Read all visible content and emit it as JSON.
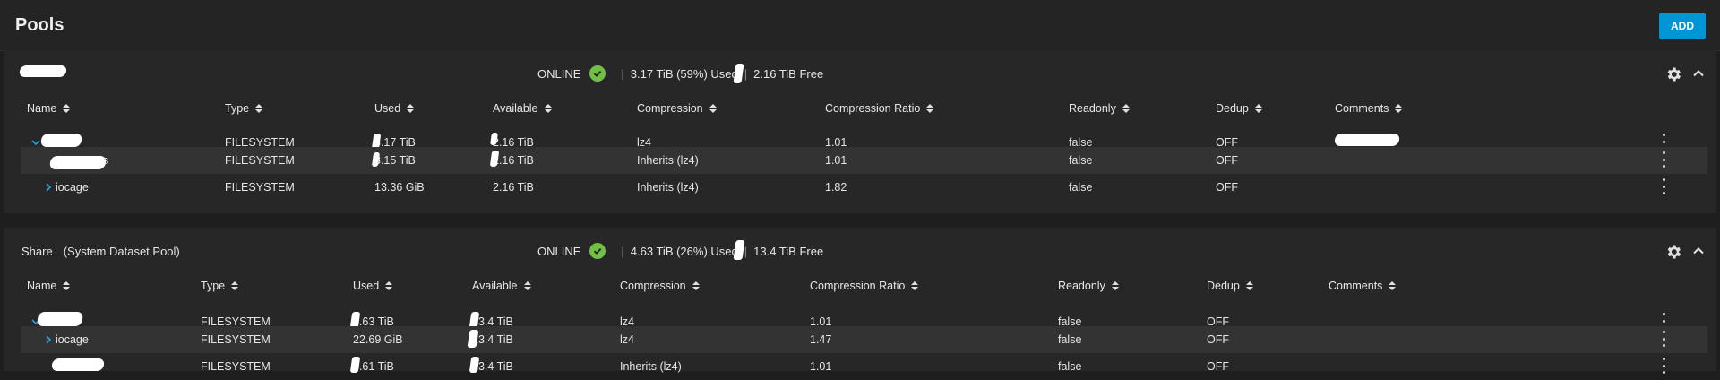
{
  "header": {
    "title": "Pools",
    "add_label": "ADD"
  },
  "columns": {
    "name": "Name",
    "type": "Type",
    "used": "Used",
    "available": "Available",
    "compression": "Compression",
    "ratio": "Compression Ratio",
    "readonly": "Readonly",
    "dedup": "Dedup",
    "comments": "Comments"
  },
  "pools": [
    {
      "name": "",
      "subtitle": "",
      "status": "ONLINE",
      "used_text": "3.17 TiB (59%) Used",
      "free_text": "2.16 TiB Free",
      "rows": [
        {
          "name": "",
          "type": "FILESYSTEM",
          "used": "3.17 TiB",
          "available": "2.16 TiB",
          "compression": "lz4",
          "ratio": "1.01",
          "readonly": "false",
          "dedup": "OFF",
          "comments": ""
        },
        {
          "name": "s",
          "type": "FILESYSTEM",
          "used": "3.15 TiB",
          "available": "2.16 TiB",
          "compression": "Inherits (lz4)",
          "ratio": "1.01",
          "readonly": "false",
          "dedup": "OFF",
          "comments": ""
        },
        {
          "name": "iocage",
          "type": "FILESYSTEM",
          "used": "13.36 GiB",
          "available": "2.16 TiB",
          "compression": "Inherits (lz4)",
          "ratio": "1.82",
          "readonly": "false",
          "dedup": "OFF",
          "comments": ""
        }
      ]
    },
    {
      "name": "Share",
      "subtitle": "(System Dataset Pool)",
      "status": "ONLINE",
      "used_text": "4.63 TiB (26%) Used",
      "free_text": "13.4 TiB Free",
      "rows": [
        {
          "name": "",
          "type": "FILESYSTEM",
          "used": "4.63 TiB",
          "available": "13.4 TiB",
          "compression": "lz4",
          "ratio": "1.01",
          "readonly": "false",
          "dedup": "OFF",
          "comments": ""
        },
        {
          "name": "iocage",
          "type": "FILESYSTEM",
          "used": "22.69 GiB",
          "available": "13.4 TiB",
          "compression": "lz4",
          "ratio": "1.47",
          "readonly": "false",
          "dedup": "OFF",
          "comments": ""
        },
        {
          "name": "",
          "type": "FILESYSTEM",
          "used": "4.61 TiB",
          "available": "13.4 TiB",
          "compression": "Inherits (lz4)",
          "ratio": "1.01",
          "readonly": "false",
          "dedup": "OFF",
          "comments": ""
        }
      ]
    }
  ],
  "colors": {
    "accent": "#0095d5",
    "online": "#71bf44",
    "row_alt": "#333333",
    "background": "#1e1e1e"
  }
}
